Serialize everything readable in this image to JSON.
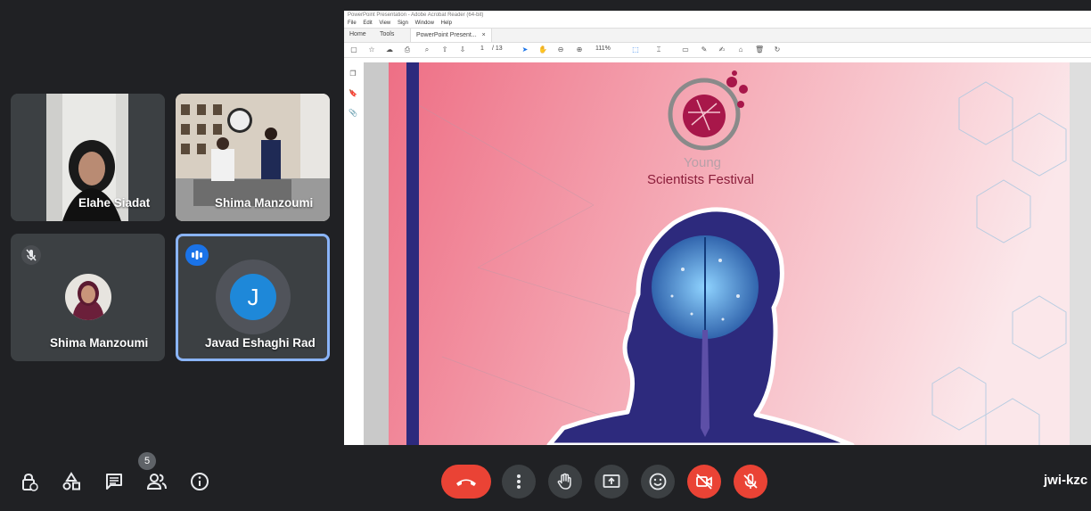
{
  "participants": [
    {
      "name": "Elahe Siadat"
    },
    {
      "name": "Shima Manzoumi"
    },
    {
      "name": "Shima Manzoumi"
    },
    {
      "name": "Javad Eshaghi Rad",
      "initial": "J"
    }
  ],
  "presentation": {
    "window_title": "PowerPoint Presentation - Adobe Acrobat Reader (64-bit)",
    "menu": [
      "File",
      "Edit",
      "View",
      "Sign",
      "Window",
      "Help"
    ],
    "tabs": {
      "home": "Home",
      "tools": "Tools",
      "doc": "PowerPoint Present...",
      "close": "×"
    },
    "page_current": "1",
    "page_total": "/ 13",
    "zoom": "111%",
    "slide": {
      "line1": "Young",
      "line2": "Scientists Festival"
    }
  },
  "controls": {
    "people_count": "5",
    "meeting_code": "jwi-kzc"
  },
  "colors": {
    "leave": "#ea4335",
    "highlight": "#8ab4f8",
    "speaking": "#1a73e8"
  }
}
